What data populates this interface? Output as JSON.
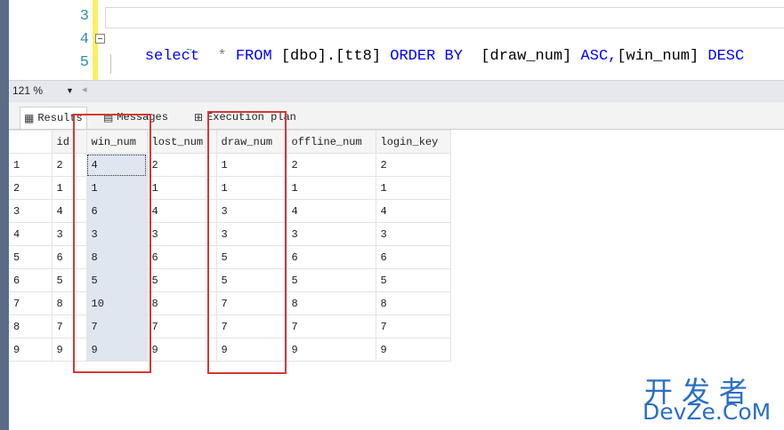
{
  "editor": {
    "line_numbers": [
      "3",
      "4",
      "5"
    ],
    "query": {
      "select": "select",
      "star": "*",
      "from": "FROM",
      "table": "[dbo].[tt8]",
      "order": "ORDER BY",
      "col1": "[draw_num]",
      "asc": "ASC,",
      "col2": "[win_num]",
      "desc": "DESC"
    }
  },
  "status": {
    "zoom": "121 %"
  },
  "tabs": [
    {
      "label": "Results",
      "icon": "grid-icon"
    },
    {
      "label": "Messages",
      "icon": "messages-icon"
    },
    {
      "label": "Execution plan",
      "icon": "execution-plan-icon"
    }
  ],
  "grid": {
    "columns": [
      "id",
      "win_num",
      "lost_num",
      "draw_num",
      "offline_num",
      "login_key"
    ],
    "rows": [
      {
        "n": "1",
        "c": [
          "2",
          "4",
          "2",
          "1",
          "2",
          "2"
        ]
      },
      {
        "n": "2",
        "c": [
          "1",
          "1",
          "1",
          "1",
          "1",
          "1"
        ]
      },
      {
        "n": "3",
        "c": [
          "4",
          "6",
          "4",
          "3",
          "4",
          "4"
        ]
      },
      {
        "n": "4",
        "c": [
          "3",
          "3",
          "3",
          "3",
          "3",
          "3"
        ]
      },
      {
        "n": "5",
        "c": [
          "6",
          "8",
          "6",
          "5",
          "6",
          "6"
        ]
      },
      {
        "n": "6",
        "c": [
          "5",
          "5",
          "5",
          "5",
          "5",
          "5"
        ]
      },
      {
        "n": "7",
        "c": [
          "8",
          "10",
          "8",
          "7",
          "8",
          "8"
        ]
      },
      {
        "n": "8",
        "c": [
          "7",
          "7",
          "7",
          "7",
          "7",
          "7"
        ]
      },
      {
        "n": "9",
        "c": [
          "9",
          "9",
          "9",
          "9",
          "9",
          "9"
        ]
      }
    ]
  },
  "watermark": {
    "cn": "开发者",
    "en": "DevZe.CoM"
  },
  "colors": {
    "keyword": "#0000ff",
    "highlight_box": "#d23a35",
    "selected_cell": "#dfe6ef"
  }
}
